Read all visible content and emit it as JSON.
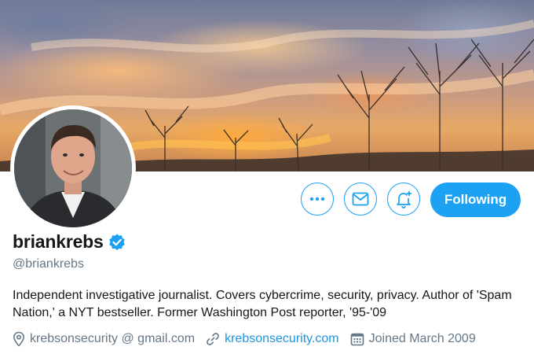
{
  "profile": {
    "display_name": "briankrebs",
    "handle": "@briankrebs",
    "verified": true,
    "bio": "Independent investigative journalist. Covers cybercrime, security, privacy. Author of 'Spam Nation,' a NYT bestseller. Former Washington Post reporter, '95-'09",
    "location": "krebsonsecurity @ gmail.com",
    "website": "krebsonsecurity.com",
    "joined": "Joined March 2009"
  },
  "actions": {
    "more_icon": "ellipsis-icon",
    "message_icon": "envelope-icon",
    "notify_icon": "bell-plus-icon",
    "follow_label": "Following"
  },
  "colors": {
    "accent": "#1da1f2",
    "link": "#1b95e0",
    "secondary_text": "#657786"
  }
}
